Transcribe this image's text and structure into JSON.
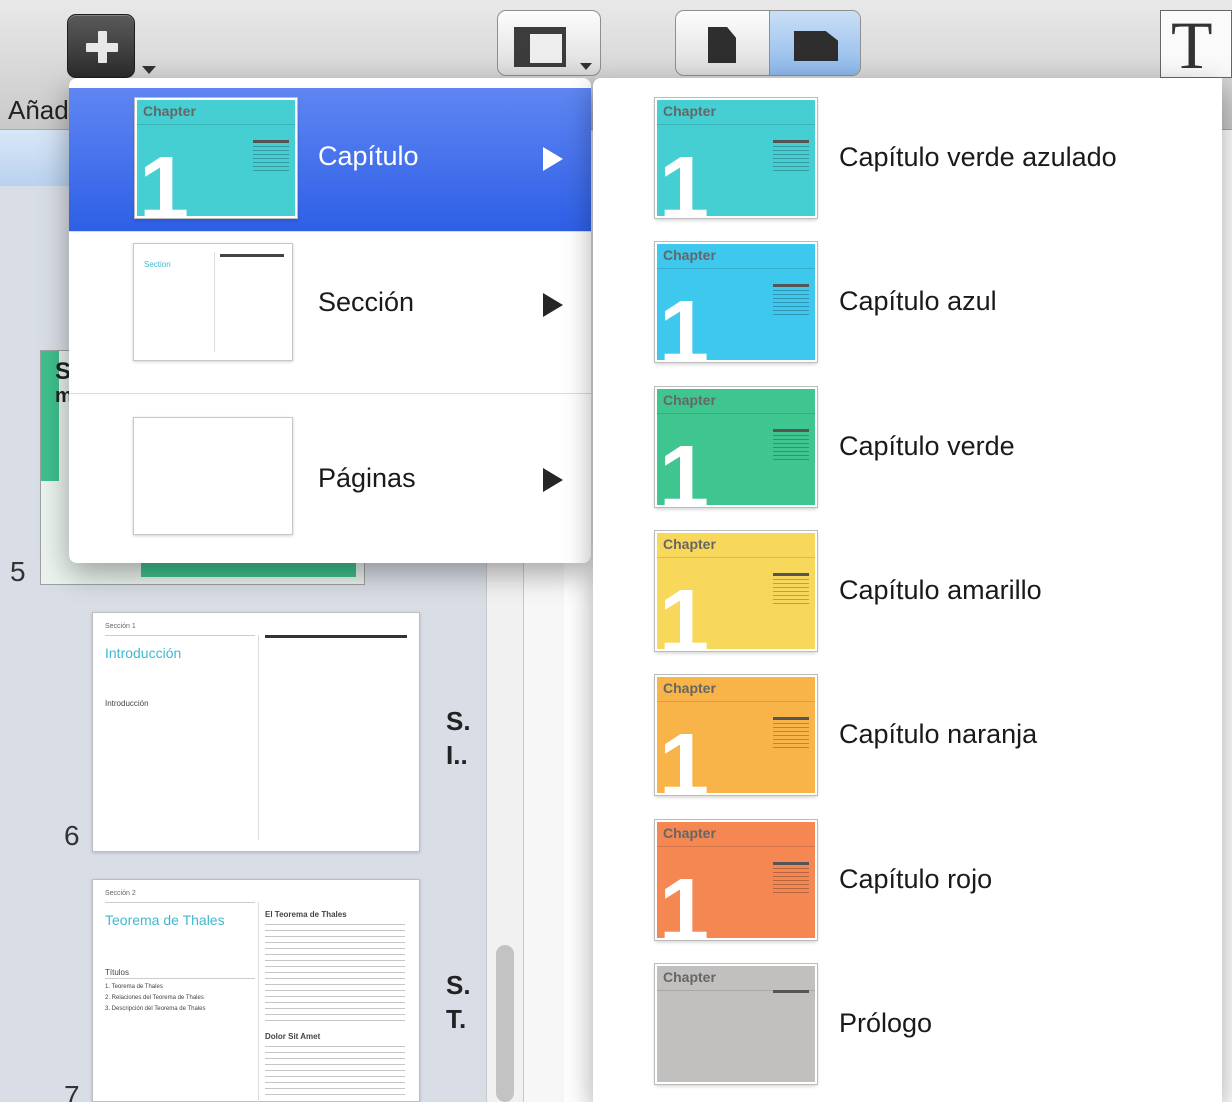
{
  "toolbar": {
    "add_label": "Añad",
    "text_icon_glyph": "T",
    "icons": {
      "add": "plus-icon",
      "view": "sidebar-view-icon",
      "portrait": "portrait-page-icon",
      "landscape": "landscape-page-icon",
      "text": "text-box-icon"
    }
  },
  "sidebar": {
    "selected_abbr": [
      "S",
      "m"
    ],
    "pages": [
      {
        "number": "5"
      },
      {
        "number": "6",
        "section": "Sección 1",
        "title": "Introducción",
        "body": "Introducción",
        "abbr": [
          "S.",
          "I.."
        ]
      },
      {
        "number": "7",
        "section": "Sección 2",
        "title": "Teorema de Thales",
        "heading": "El Teorema de Thales",
        "toc_title": "Títulos",
        "toc": [
          "1. Teorema de Thales",
          "2. Relaciones del Teorema de Thales",
          "3. Descripción del Teorema de Thales"
        ],
        "subheading": "Dolor Sit Amet",
        "abbr": [
          "S.",
          "T."
        ]
      }
    ]
  },
  "menu": {
    "items": [
      {
        "label": "Capítulo",
        "selected": true
      },
      {
        "label": "Sección",
        "selected": false,
        "thumb_title": "Section"
      },
      {
        "label": "Páginas",
        "selected": false
      }
    ]
  },
  "submenu": {
    "chapter_word": "Chapter",
    "chapter_number": "1",
    "items": [
      {
        "label": "Capítulo verde azulado",
        "color": "#45cfd3"
      },
      {
        "label": "Capítulo azul",
        "color": "#3ec8ee"
      },
      {
        "label": "Capítulo verde",
        "color": "#3fc590"
      },
      {
        "label": "Capítulo amarillo",
        "color": "#f8d85a"
      },
      {
        "label": "Capítulo naranja",
        "color": "#f8b448"
      },
      {
        "label": "Capítulo rojo",
        "color": "#f48752"
      },
      {
        "label": "Prólogo",
        "color": "#c2c0bf"
      }
    ]
  },
  "colors": {
    "selection_top": "#5f86f2",
    "selection_bottom": "#2e5fe6",
    "section_title": "#3fb9d1"
  }
}
